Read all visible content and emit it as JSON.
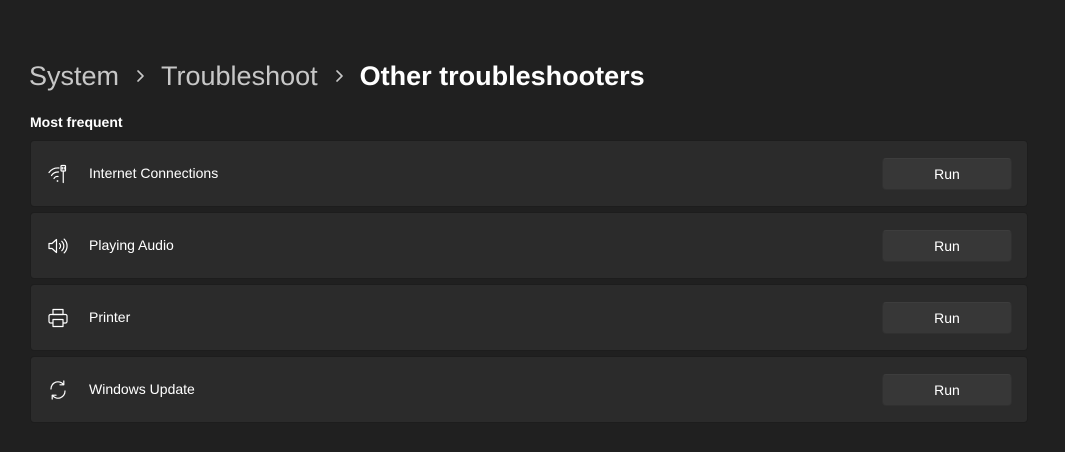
{
  "breadcrumb": {
    "items": [
      "System",
      "Troubleshoot"
    ],
    "current": "Other troubleshooters"
  },
  "section": {
    "title": "Most frequent"
  },
  "troubleshooters": [
    {
      "label": "Internet Connections",
      "icon": "wifi-icon",
      "button_label": "Run"
    },
    {
      "label": "Playing Audio",
      "icon": "speaker-icon",
      "button_label": "Run"
    },
    {
      "label": "Printer",
      "icon": "printer-icon",
      "button_label": "Run"
    },
    {
      "label": "Windows Update",
      "icon": "sync-icon",
      "button_label": "Run"
    }
  ],
  "colors": {
    "background": "#202020",
    "card": "#2b2b2b",
    "button": "#373737",
    "muted_text": "#c7c7c7",
    "text": "#ffffff"
  }
}
